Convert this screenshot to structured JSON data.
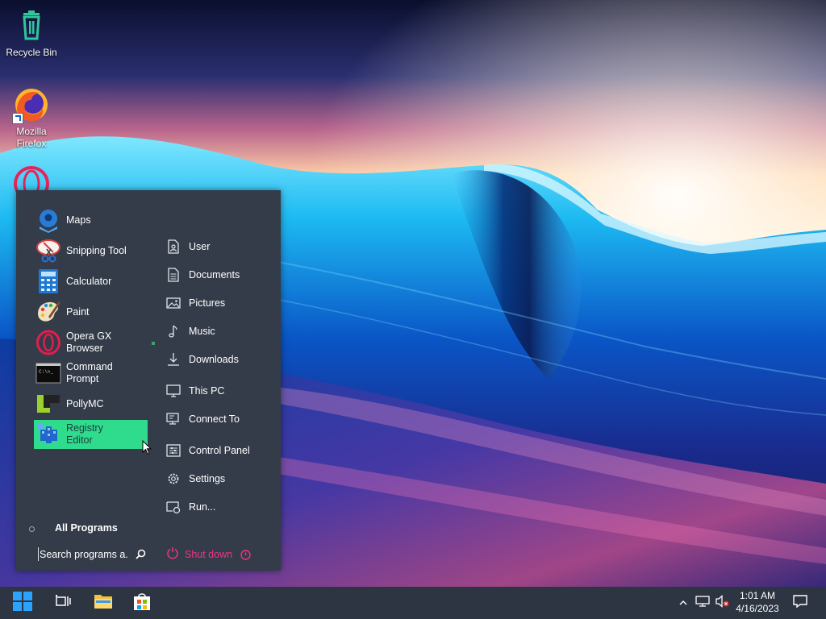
{
  "desktop": {
    "icons": [
      {
        "label": "Recycle Bin",
        "icon": "recycle-bin-icon"
      },
      {
        "label": "Mozilla Firefox",
        "icon": "firefox-icon"
      },
      {
        "label": "",
        "icon": "opera-icon"
      }
    ]
  },
  "start_menu": {
    "apps": [
      {
        "label": "Maps",
        "icon": "maps-icon"
      },
      {
        "label": "Snipping Tool",
        "icon": "snipping-tool-icon"
      },
      {
        "label": "Calculator",
        "icon": "calculator-icon"
      },
      {
        "label": "Paint",
        "icon": "paint-icon"
      },
      {
        "label": "Opera GX Browser",
        "icon": "opera-gx-icon",
        "has_submenu": true
      },
      {
        "label": "Command Prompt",
        "icon": "command-prompt-icon"
      },
      {
        "label": "PollyMC",
        "icon": "pollymc-icon"
      },
      {
        "label": "Registry Editor",
        "icon": "registry-editor-icon",
        "selected": true
      }
    ],
    "places": [
      {
        "label": "User",
        "icon": "user-file-icon"
      },
      {
        "label": "Documents",
        "icon": "documents-icon"
      },
      {
        "label": "Pictures",
        "icon": "pictures-icon"
      },
      {
        "label": "Music",
        "icon": "music-icon"
      },
      {
        "label": "Downloads",
        "icon": "downloads-icon"
      },
      {
        "label": "This PC",
        "icon": "this-pc-icon"
      },
      {
        "label": "Connect To",
        "icon": "connect-to-icon"
      },
      {
        "label": "Control Panel",
        "icon": "control-panel-icon"
      },
      {
        "label": "Settings",
        "icon": "settings-gear-icon"
      },
      {
        "label": "Run...",
        "icon": "run-icon"
      }
    ],
    "all_programs_label": "All Programs",
    "search_placeholder": "Search programs a...",
    "shutdown_label": "Shut down"
  },
  "taskbar": {
    "clock_time": "1:01 AM",
    "clock_date": "4/16/2023"
  },
  "colors": {
    "menu_bg": "#343c49",
    "taskbar_bg": "#2e3542",
    "selected_item": "#2fdc8e",
    "shutdown_accent": "#f0328a"
  }
}
